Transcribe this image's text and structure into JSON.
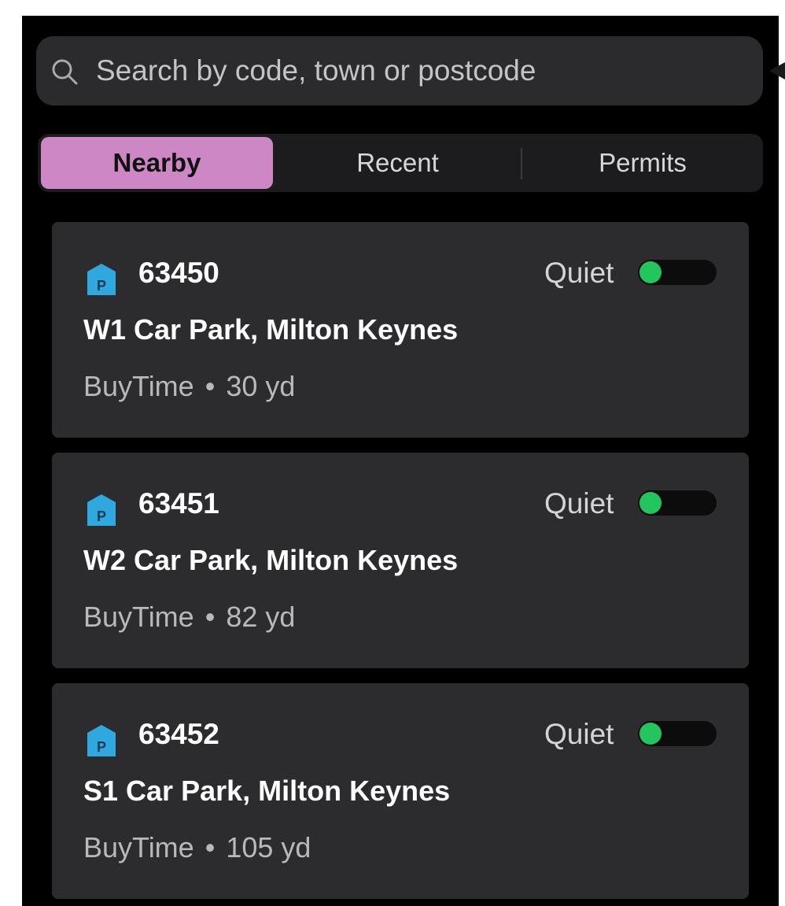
{
  "search": {
    "placeholder": "Search by code, town or postcode",
    "icon": "search-icon"
  },
  "tabs": [
    {
      "label": "Nearby",
      "active": true
    },
    {
      "label": "Recent",
      "active": false
    },
    {
      "label": "Permits",
      "active": false
    }
  ],
  "colors": {
    "accent": "#cd87c4",
    "background": "#000000",
    "card": "#2c2c2e",
    "parking_icon": "#2fa8e0",
    "status_dot": "#22c55e"
  },
  "locations": [
    {
      "code": "63450",
      "name": "W1 Car Park, Milton Keynes",
      "service": "BuyTime",
      "separator": "•",
      "distance": "30 yd",
      "status": "Quiet",
      "icon": "parking-icon"
    },
    {
      "code": "63451",
      "name": "W2 Car Park, Milton Keynes",
      "service": "BuyTime",
      "separator": "•",
      "distance": "82 yd",
      "status": "Quiet",
      "icon": "parking-icon"
    },
    {
      "code": "63452",
      "name": "S1 Car Park, Milton Keynes",
      "service": "BuyTime",
      "separator": "•",
      "distance": "105 yd",
      "status": "Quiet",
      "icon": "parking-icon"
    }
  ]
}
